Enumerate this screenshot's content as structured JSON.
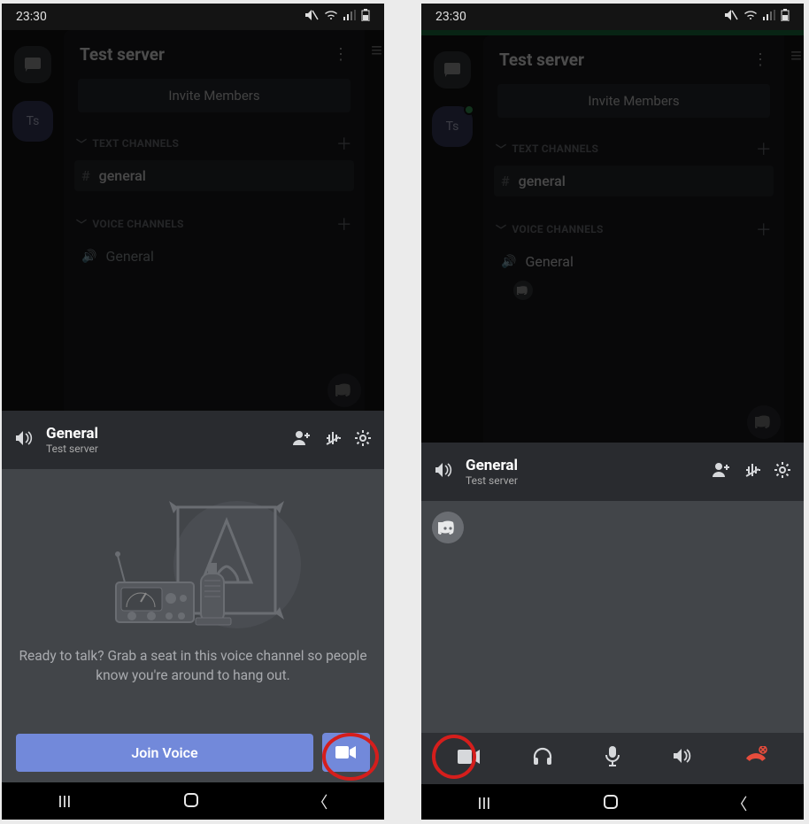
{
  "status": {
    "time": "23:30"
  },
  "server": {
    "badge": "Ts",
    "title": "Test server",
    "invite": "Invite Members",
    "cat_text": "TEXT CHANNELS",
    "cat_voice": "VOICE CHANNELS",
    "text_channel": "general",
    "voice_channel": "General"
  },
  "voice_header": {
    "channel": "General",
    "server": "Test server"
  },
  "panel_a": {
    "empty_text": "Ready to talk? Grab a seat in this voice channel so people know you're around to hang out.",
    "join_label": "Join Voice"
  }
}
